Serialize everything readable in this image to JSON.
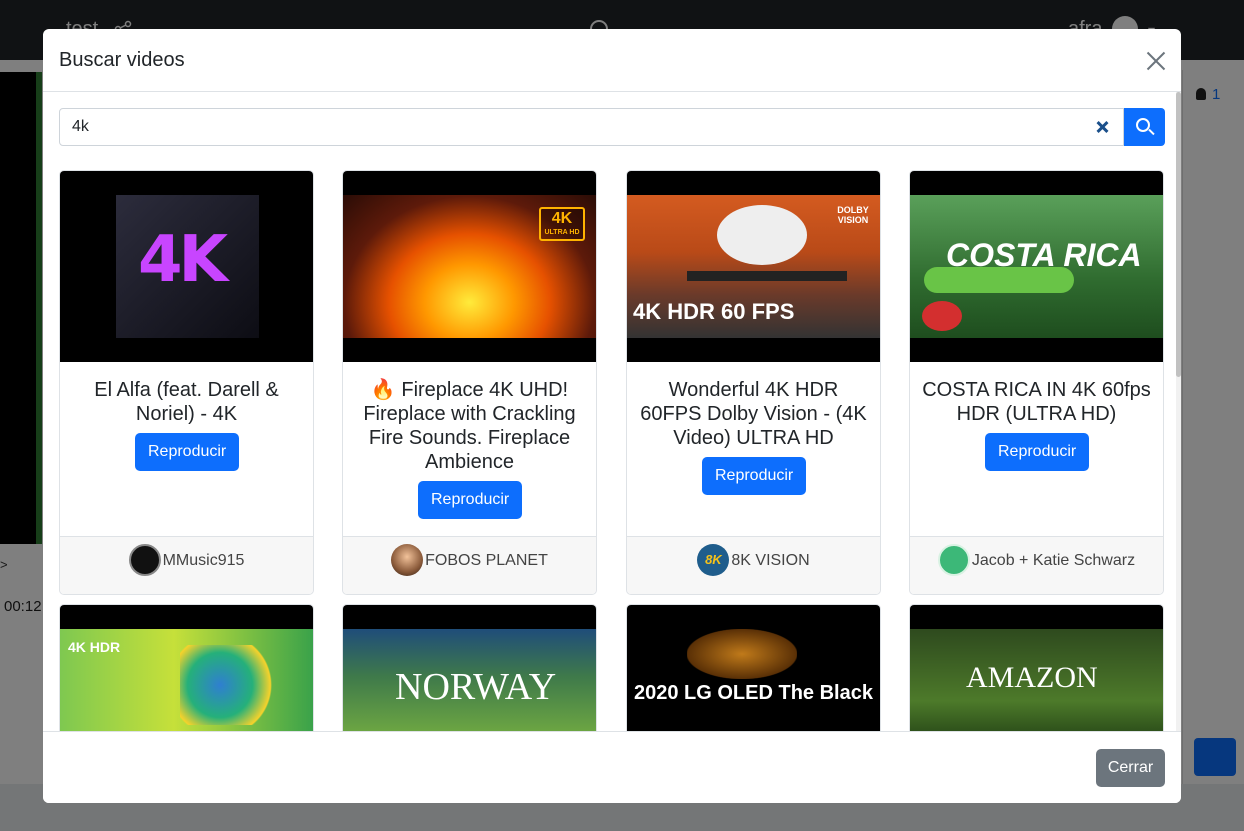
{
  "app": {
    "topbar_title": "test",
    "username": "afra",
    "viewer_count": "1",
    "timeline_marker": ">",
    "time_display": "00:12"
  },
  "modal": {
    "title": "Buscar videos",
    "search": {
      "value": "4k",
      "placeholder": ""
    },
    "results": [
      {
        "title": "El Alfa (feat. Darell & Noriel) - 4K",
        "play_label": "Reproducir",
        "channel": "MMusic915",
        "thumb_text": "4K"
      },
      {
        "title": "🔥 Fireplace 4K UHD! Fireplace with Crackling Fire Sounds. Fireplace Ambience",
        "play_label": "Reproducir",
        "channel": "FOBOS PLANET",
        "thumb_badge": "4K",
        "thumb_badge_sub": "ULTRA HD"
      },
      {
        "title": "Wonderful 4K HDR 60FPS Dolby Vision - (4K Video) ULTRA HD",
        "play_label": "Reproducir",
        "channel": "8K VISION",
        "thumb_label": "4K HDR 60 FPS",
        "thumb_brand": "DOLBY VISION",
        "channel_avatar_text": "8K"
      },
      {
        "title": "COSTA RICA IN 4K 60fps HDR (ULTRA HD)",
        "play_label": "Reproducir",
        "channel": "Jacob + Katie Schwarz",
        "thumb_text": "COSTA RICA"
      },
      {
        "thumb_text": "4K HDR"
      },
      {
        "thumb_text": "NORWAY"
      },
      {
        "thumb_text": "2020 LG OLED The Black"
      },
      {
        "thumb_text": "AMAZON"
      }
    ],
    "close_label": "Cerrar"
  },
  "colors": {
    "primary": "#0d6efd",
    "secondary": "#6c757d",
    "backdrop": "rgba(0,0,0,0.5)"
  }
}
